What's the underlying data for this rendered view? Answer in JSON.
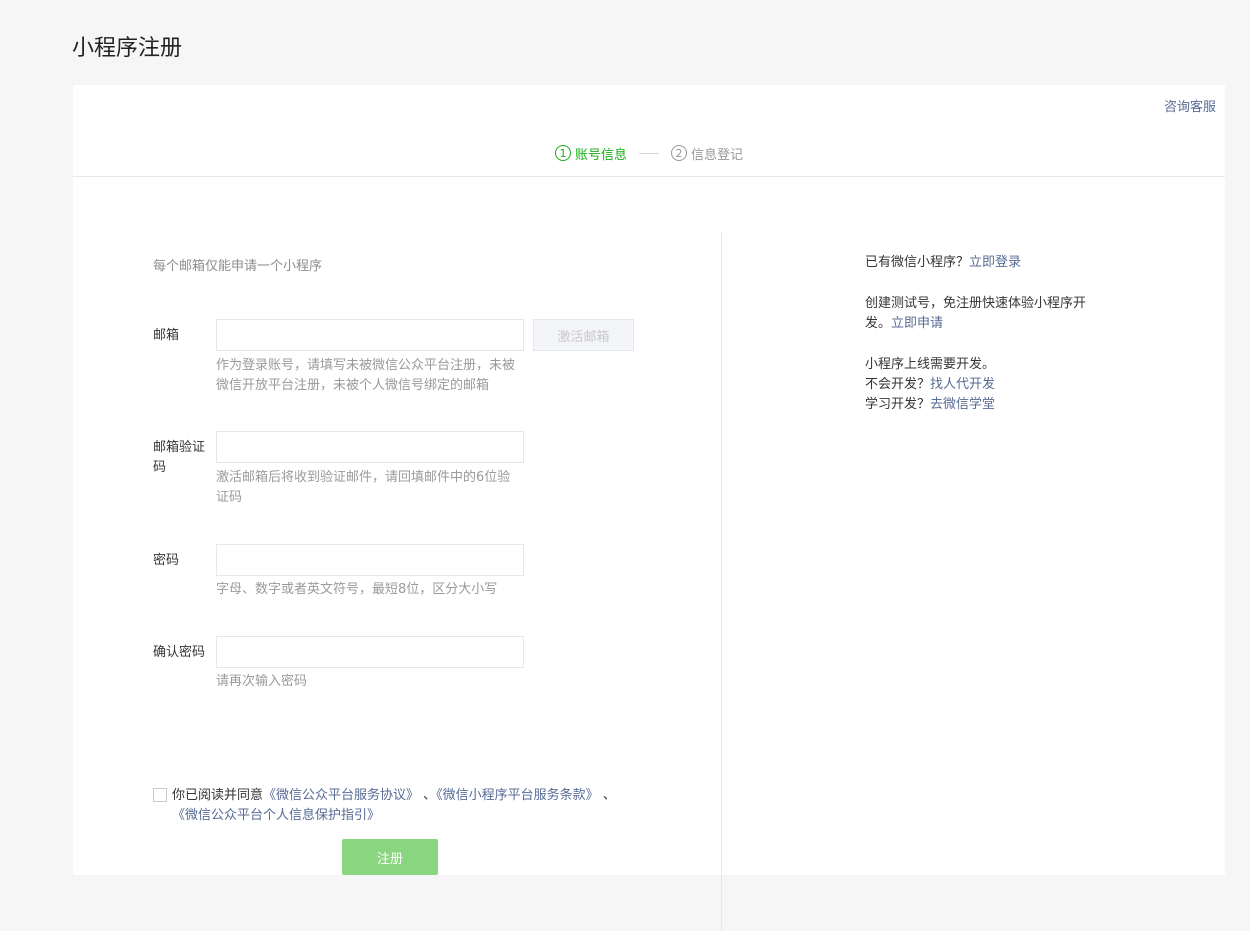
{
  "page": {
    "title": "小程序注册"
  },
  "header": {
    "consult_label": "咨询客服"
  },
  "steps": [
    {
      "num": "1",
      "label": "账号信息"
    },
    {
      "num": "2",
      "label": "信息登记"
    }
  ],
  "form": {
    "tip": "每个邮箱仅能申请一个小程序",
    "email": {
      "label": "邮箱",
      "value": "",
      "placeholder": "",
      "hint": "作为登录账号，请填写未被微信公众平台注册，未被微信开放平台注册，未被个人微信号绑定的邮箱",
      "activate_label": "激活邮箱"
    },
    "code": {
      "label": "邮箱验证码",
      "value": "",
      "placeholder": "",
      "hint": "激活邮箱后将收到验证邮件，请回填邮件中的6位验证码"
    },
    "password": {
      "label": "密码",
      "value": "",
      "placeholder": "",
      "hint": "字母、数字或者英文符号，最短8位，区分大小写"
    },
    "confirm": {
      "label": "确认密码",
      "value": "",
      "placeholder": "",
      "hint": "请再次输入密码"
    },
    "agreement": {
      "prefix": "你已阅读并同意",
      "link1": "《微信公众平台服务协议》",
      "sep1": " 、",
      "link2": "《微信小程序平台服务条款》",
      "sep2": " 、",
      "link3": "《微信公众平台个人信息保护指引》"
    },
    "register_label": "注册"
  },
  "side": {
    "has_account_text": "已有微信小程序？",
    "login_link": "立即登录",
    "test_text": "创建测试号，免注册快速体验小程序开发。",
    "test_link": "立即申请",
    "online_text": "小程序上线需要开发。",
    "no_dev_text": "不会开发？",
    "no_dev_link": "找人代开发",
    "learn_text": "学习开发？",
    "learn_link": "去微信学堂"
  }
}
